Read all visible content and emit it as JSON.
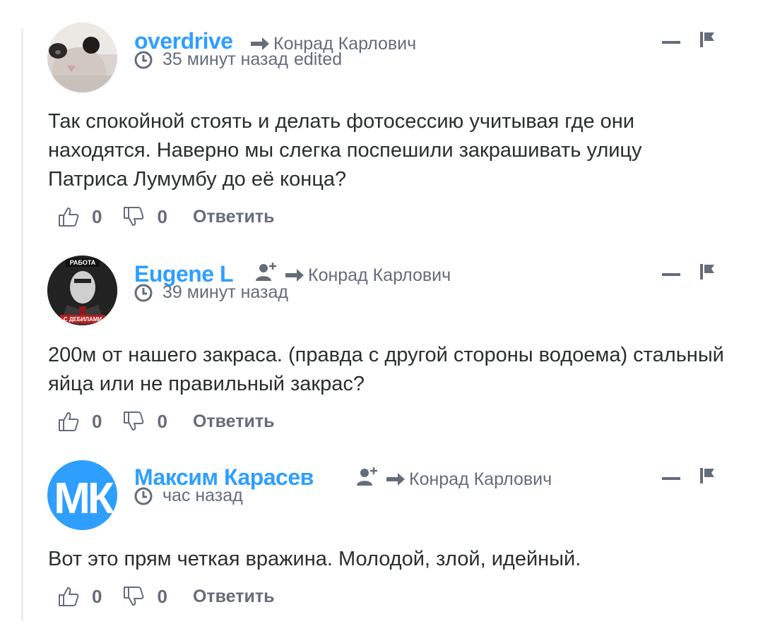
{
  "comments": [
    {
      "author": "overdrive",
      "reply_to": "Конрад Карлович",
      "time": "35 минут назад",
      "edited": "edited",
      "text": "Так спокойной стоять и делать фотосессию учитывая где они находятся. Наверно мы слегка поспешили закрашивать улицу Патриса Лумумбу до её конца?",
      "likes": "0",
      "dislikes": "0",
      "reply_label": "Ответить"
    },
    {
      "author": "Eugene L",
      "reply_to": "Конрад Карлович",
      "time": "39 минут назад",
      "text": "200м от нашего закраса. (правда с другой стороны водоема) стальный яйца или не правильный закрас?",
      "likes": "0",
      "dislikes": "0",
      "reply_label": "Ответить",
      "avatar_caption_top": "РАБОТА",
      "avatar_caption_bottom": "С ДЕБИЛАМИ"
    },
    {
      "author": "Максим Карасев",
      "reply_to": "Конрад Карлович",
      "time": "час назад",
      "text": "Вот это прям четкая вражина. Молодой, злой, идейный.",
      "likes": "0",
      "dislikes": "0",
      "reply_label": "Ответить",
      "avatar_initials": "МК"
    }
  ],
  "colors": {
    "author_link": "#2e9fff",
    "meta_gray": "#656c7a",
    "text": "#2a2e2e",
    "thread_line": "#eceef0"
  },
  "icons": [
    "clock-icon",
    "reply-arrow-icon",
    "add-user-icon",
    "collapse-icon",
    "flag-icon",
    "thumb-up-icon",
    "thumb-down-icon"
  ]
}
